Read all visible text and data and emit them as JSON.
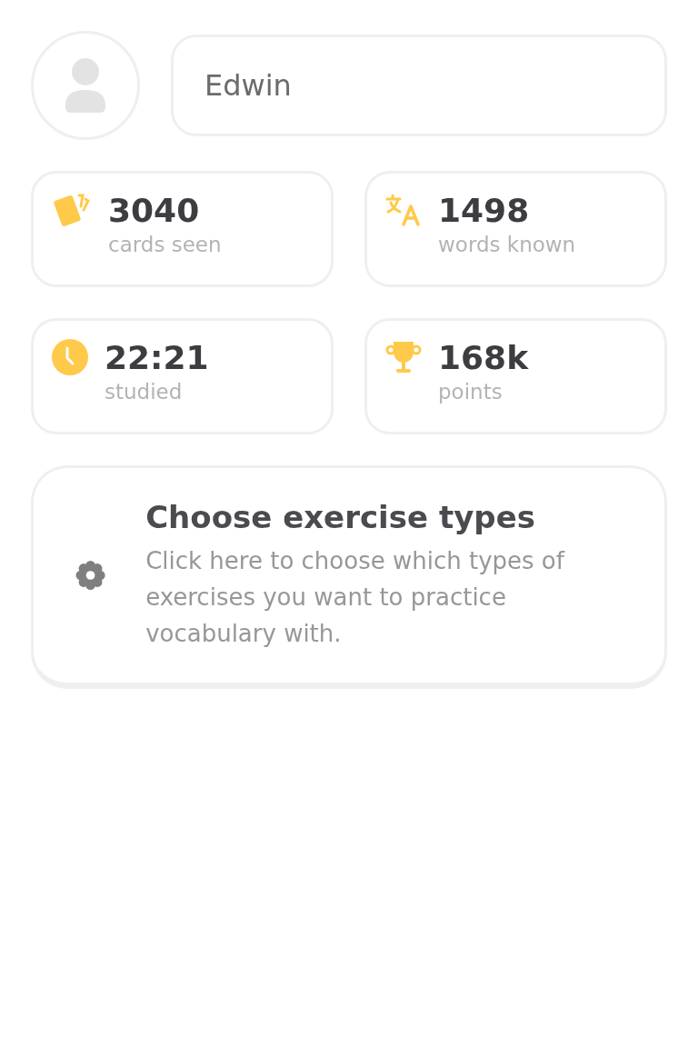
{
  "profile": {
    "name": "Edwin"
  },
  "stats": [
    {
      "kind": "cards",
      "value": "3040",
      "label": "cards seen"
    },
    {
      "kind": "translate",
      "value": "1498",
      "label": "words known"
    },
    {
      "kind": "clock",
      "value": "22:21",
      "label": "studied"
    },
    {
      "kind": "trophy",
      "value": "168k",
      "label": "points"
    }
  ],
  "exercise_card": {
    "title": "Choose exercise types",
    "description": "Click here to choose which types of exercises you want to practice vocabulary with."
  }
}
